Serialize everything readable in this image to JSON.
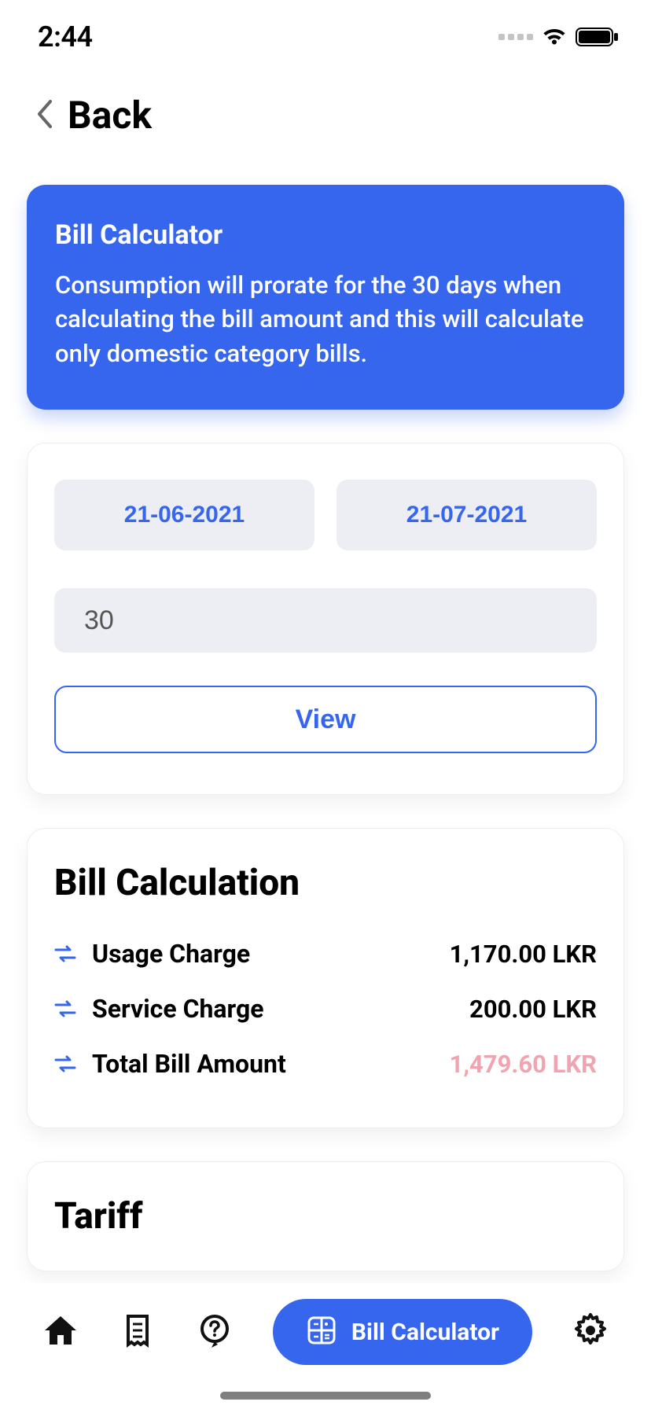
{
  "status": {
    "time": "2:44"
  },
  "back": {
    "label": "Back"
  },
  "info": {
    "title": "Bill Calculator",
    "description": "Consumption will prorate for the 30 days when calculating the bill amount and this will calculate only domestic category bills."
  },
  "form": {
    "date_from": "21-06-2021",
    "date_to": "21-07-2021",
    "units_value": "30",
    "view_label": "View"
  },
  "calc": {
    "title": "Bill Calculation",
    "rows": [
      {
        "label": "Usage Charge",
        "value": "1,170.00 LKR"
      },
      {
        "label": "Service Charge",
        "value": "200.00 LKR"
      },
      {
        "label": "Total Bill Amount",
        "value": "1,479.60 LKR"
      }
    ]
  },
  "tariff": {
    "title": "Tariff"
  },
  "nav": {
    "active_label": "Bill Calculator"
  }
}
